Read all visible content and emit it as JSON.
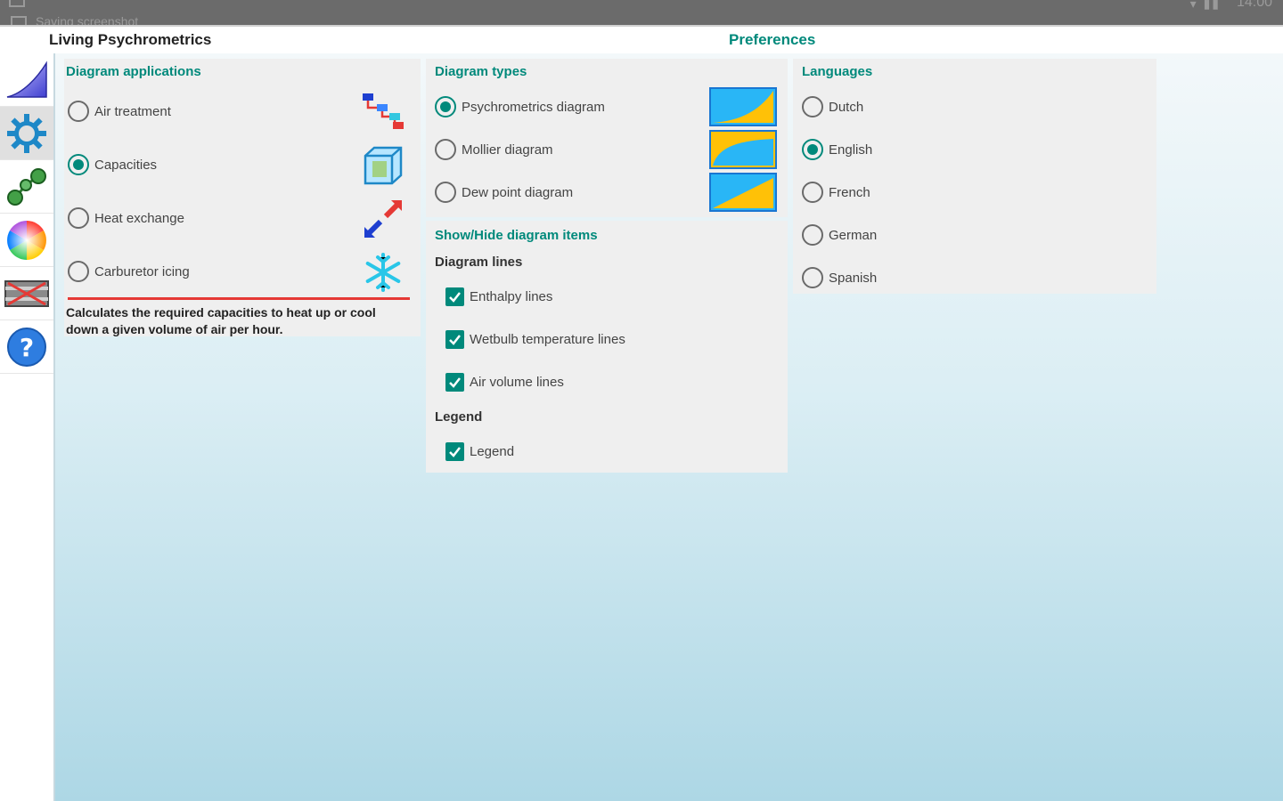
{
  "status_bar": {
    "notification_text": "Saving screenshot",
    "clock": "14:00"
  },
  "app": {
    "title": "Living Psychrometrics",
    "screen_title": "Preferences"
  },
  "sidebar": {
    "items": [
      {
        "icon": "psychrometric-chart-icon"
      },
      {
        "icon": "gear-icon",
        "active": true
      },
      {
        "icon": "process-nodes-icon"
      },
      {
        "icon": "color-wheel-icon"
      },
      {
        "icon": "heat-exchanger-icon"
      },
      {
        "icon": "help-icon"
      }
    ]
  },
  "diagram_applications": {
    "title": "Diagram applications",
    "options": [
      {
        "label": "Air treatment",
        "checked": false,
        "icon": "air-treatment-icon"
      },
      {
        "label": "Capacities",
        "checked": true,
        "icon": "cube-icon"
      },
      {
        "label": "Heat exchange",
        "checked": false,
        "icon": "heat-exchange-arrows-icon"
      },
      {
        "label": "Carburetor icing",
        "checked": false,
        "icon": "snowflake-icon"
      }
    ],
    "description": "Calculates the required capacities to heat up or cool down a given volume of air per hour."
  },
  "diagram_types": {
    "title": "Diagram types",
    "options": [
      {
        "label": "Psychrometrics diagram",
        "checked": true
      },
      {
        "label": "Mollier diagram",
        "checked": false
      },
      {
        "label": "Dew point diagram",
        "checked": false
      }
    ]
  },
  "show_hide": {
    "title": "Show/Hide diagram items",
    "diagram_lines_title": "Diagram lines",
    "lines": [
      {
        "label": "Enthalpy lines",
        "checked": true
      },
      {
        "label": "Wetbulb temperature lines",
        "checked": true
      },
      {
        "label": "Air volume lines",
        "checked": true
      }
    ],
    "legend_title": "Legend",
    "legend": {
      "label": "Legend",
      "checked": true
    }
  },
  "languages": {
    "title": "Languages",
    "options": [
      {
        "label": "Dutch",
        "checked": false
      },
      {
        "label": "English",
        "checked": true
      },
      {
        "label": "French",
        "checked": false
      },
      {
        "label": "German",
        "checked": false
      },
      {
        "label": "Spanish",
        "checked": false
      }
    ]
  },
  "colors": {
    "accent": "#00897b",
    "divider": "#e53935",
    "thumb_blue": "#29b6f6",
    "thumb_yellow": "#ffc107"
  }
}
